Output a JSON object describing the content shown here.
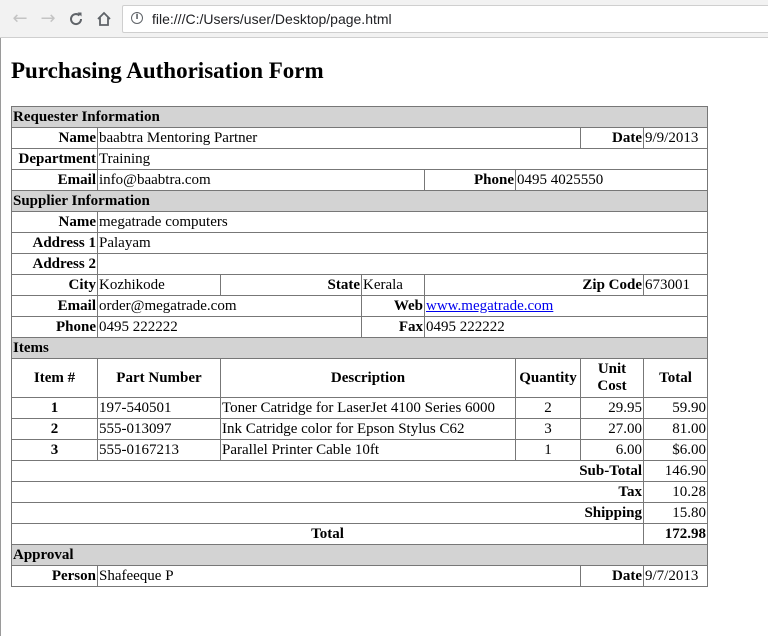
{
  "browser": {
    "url": "file:///C:/Users/user/Desktop/page.html"
  },
  "page": {
    "title": "Purchasing Authorisation Form"
  },
  "requester": {
    "section": "Requester Information",
    "name_label": "Name",
    "name": "baabtra Mentoring Partner",
    "date_label": "Date",
    "date": "9/9/2013",
    "department_label": "Department",
    "department": "Training",
    "email_label": "Email",
    "email": "info@baabtra.com",
    "phone_label": "Phone",
    "phone": "0495 4025550"
  },
  "supplier": {
    "section": "Supplier Information",
    "name_label": "Name",
    "name": "megatrade computers",
    "address1_label": "Address 1",
    "address1": "Palayam",
    "address2_label": "Address 2",
    "address2": "",
    "city_label": "City",
    "city": "Kozhikode",
    "state_label": "State",
    "state": "Kerala",
    "zip_label": "Zip Code",
    "zip": "673001",
    "email_label": "Email",
    "email": "order@megatrade.com",
    "web_label": "Web",
    "web": "www.megatrade.com",
    "phone_label": "Phone",
    "phone": "0495 222222",
    "fax_label": "Fax",
    "fax": "0495 222222"
  },
  "items": {
    "section": "Items",
    "headers": {
      "item": "Item #",
      "part": "Part Number",
      "description": "Description",
      "quantity": "Quantity",
      "unit_cost_1": "Unit",
      "unit_cost_2": "Cost",
      "total": "Total"
    },
    "rows": [
      {
        "item": "1",
        "part": "197-540501",
        "description": "Toner Catridge for LaserJet 4100 Series 6000",
        "quantity": "2",
        "unit_cost": "29.95",
        "total": "59.90"
      },
      {
        "item": "2",
        "part": "555-013097",
        "description": "Ink Catridge color for Epson Stylus C62",
        "quantity": "3",
        "unit_cost": "27.00",
        "total": "81.00"
      },
      {
        "item": "3",
        "part": "555-0167213",
        "description": "Parallel Printer Cable 10ft",
        "quantity": "1",
        "unit_cost": "6.00",
        "total": "$6.00"
      }
    ],
    "subtotal_label": "Sub-Total",
    "subtotal": "146.90",
    "tax_label": "Tax",
    "tax": "10.28",
    "shipping_label": "Shipping",
    "shipping": "15.80",
    "grand_total_label": "Total",
    "grand_total": "172.98"
  },
  "approval": {
    "section": "Approval",
    "person_label": "Person",
    "person": "Shafeeque P",
    "date_label": "Date",
    "date": "9/7/2013"
  }
}
